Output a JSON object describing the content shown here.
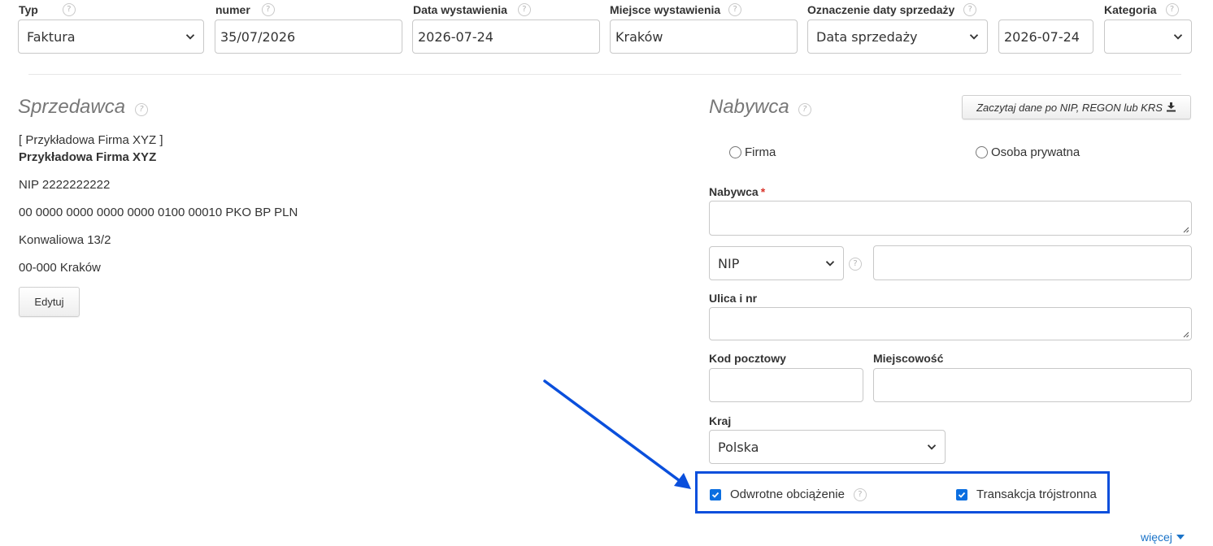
{
  "top_fields": {
    "typ": {
      "label": "Typ",
      "value": "Faktura"
    },
    "numer": {
      "label": "numer",
      "value": "35/07/2026"
    },
    "data_wystawienia": {
      "label": "Data wystawienia",
      "value": "2026-07-24"
    },
    "miejsce_wystawienia": {
      "label": "Miejsce wystawienia",
      "value": "Kraków"
    },
    "oznaczenie_daty": {
      "label": "Oznaczenie daty sprzedaży",
      "value": "Data sprzedaży"
    },
    "data_sprzedazy": {
      "value": "2026-07-24"
    },
    "kategoria": {
      "label": "Kategoria",
      "value": ""
    }
  },
  "seller": {
    "heading": "Sprzedawca",
    "line1": "[ Przykładowa Firma XYZ ]",
    "name": "Przykładowa Firma XYZ",
    "nip": "NIP 2222222222",
    "bank": "00 0000 0000 0000 0000 0100 00010 PKO BP PLN",
    "street": "Konwaliowa 13/2",
    "city": "00-000 Kraków",
    "edit_label": "Edytuj"
  },
  "buyer": {
    "heading": "Nabywca",
    "fetch_button": "Zaczytaj dane po NIP, REGON lub KRS",
    "radio_firma": "Firma",
    "radio_osoba": "Osoba prywatna",
    "name_label": "Nabywca",
    "required_mark": "*",
    "id_type": "NIP",
    "street_label": "Ulica i nr",
    "postal_label": "Kod pocztowy",
    "city_label": "Miejscowość",
    "country_label": "Kraj",
    "country_value": "Polska"
  },
  "options": {
    "reverse_charge": "Odwrotne obciążenie",
    "triangular": "Transakcja trójstronna",
    "more": "więcej"
  },
  "colors": {
    "annotation": "#0a4fdc",
    "checkbox": "#0b6ee0",
    "link": "#1a73c8"
  },
  "icons": [
    "help-icon",
    "chevron-down-icon",
    "download-icon",
    "resize-grip-icon",
    "check-icon",
    "arrow-annotation",
    "caret-down-icon"
  ]
}
